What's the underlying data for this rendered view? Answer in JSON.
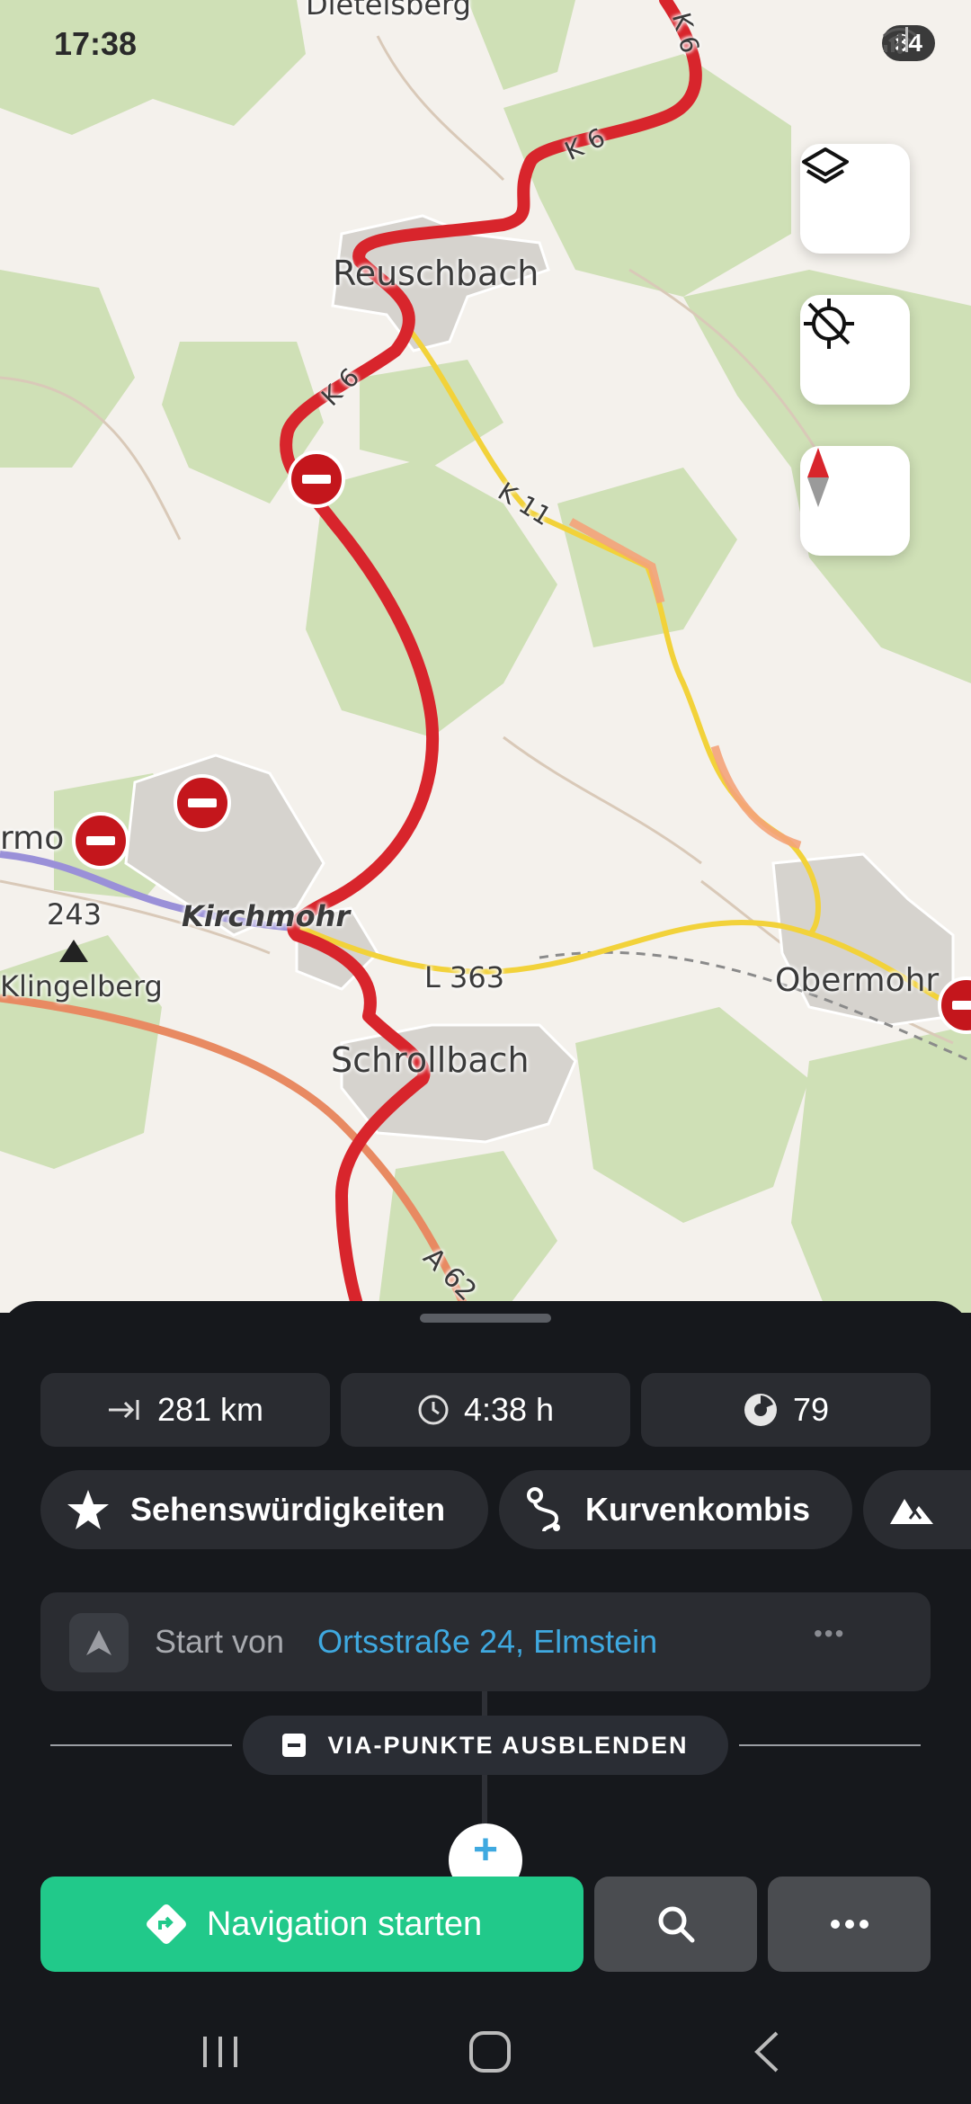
{
  "status_bar": {
    "time": "17:38",
    "battery": "84"
  },
  "map": {
    "labels": {
      "dietelsberg": "Dietelsberg",
      "reuschbach": "Reuschbach",
      "k6_a": "K 6",
      "k6_b": "K 6",
      "k6_c": "K 6",
      "k11": "K 11",
      "ermo": "rmo",
      "elev": "243",
      "klingelberg": "Klingelberg",
      "kirchmohr": "Kirchmohr",
      "l363": "L 363",
      "obermohr": "Obermohr",
      "schrollbach": "Schrollbach",
      "a62": "A 62"
    },
    "buttons": [
      "layers-icon",
      "gps-off-icon",
      "compass-icon"
    ]
  },
  "sheet": {
    "stats": {
      "distance": "281 km",
      "duration": "4:38 h",
      "score": "79"
    },
    "chips": {
      "sights": "Sehenswürdigkeiten",
      "curves": "Kurvenkombis"
    },
    "start": {
      "prefix": "Start von",
      "address": "Ortsstraße 24, Elmstein",
      "more": "•••"
    },
    "via_toggle": "VIA-PUNKTE AUSBLENDEN",
    "add": "+",
    "navigate_label": "Navigation starten"
  },
  "colors": {
    "route": "#d8252c",
    "accent": "#21c98a",
    "link": "#3fa9e0",
    "sheet": "#16181c"
  }
}
